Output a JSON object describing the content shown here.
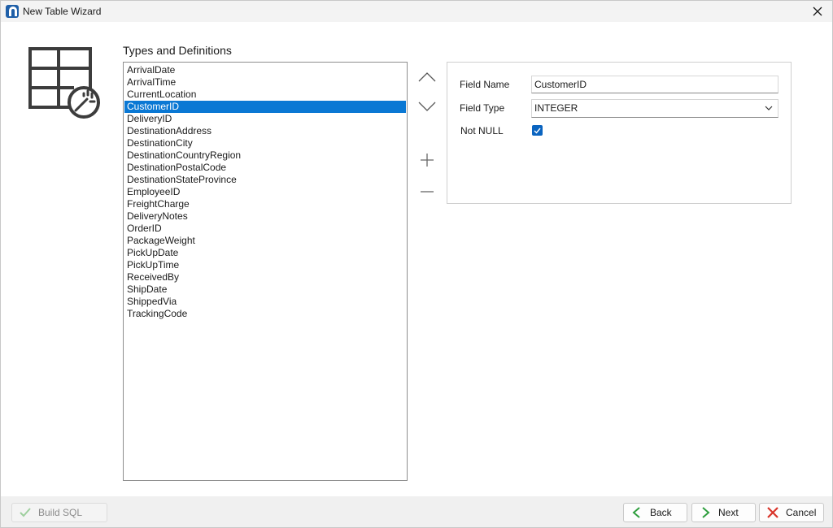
{
  "window": {
    "title": "New Table Wizard",
    "icon": "app-logo-icon"
  },
  "section_title": "Types and Definitions",
  "fields": [
    "ArrivalDate",
    "ArrivalTime",
    "CurrentLocation",
    "CustomerID",
    "DeliveryID",
    "DestinationAddress",
    "DestinationCity",
    "DestinationCountryRegion",
    "DestinationPostalCode",
    "DestinationStateProvince",
    "EmployeeID",
    "FreightCharge",
    "DeliveryNotes",
    "OrderID",
    "PackageWeight",
    "PickUpDate",
    "PickUpTime",
    "ReceivedBy",
    "ShipDate",
    "ShippedVia",
    "TrackingCode"
  ],
  "selected_field": "CustomerID",
  "properties": {
    "field_name_label": "Field Name",
    "field_name_value": "CustomerID",
    "field_type_label": "Field Type",
    "field_type_value": "INTEGER",
    "not_null_label": "Not NULL",
    "not_null_checked": true
  },
  "buttons": {
    "build_sql": "Build SQL",
    "back": "Back",
    "next": "Next",
    "cancel": "Cancel"
  },
  "colors": {
    "selection": "#0a78d4",
    "checkbox": "#0a64c0",
    "back_arrow": "#2e9e3e",
    "next_arrow": "#2e9e3e",
    "cancel_x": "#d9352b"
  }
}
